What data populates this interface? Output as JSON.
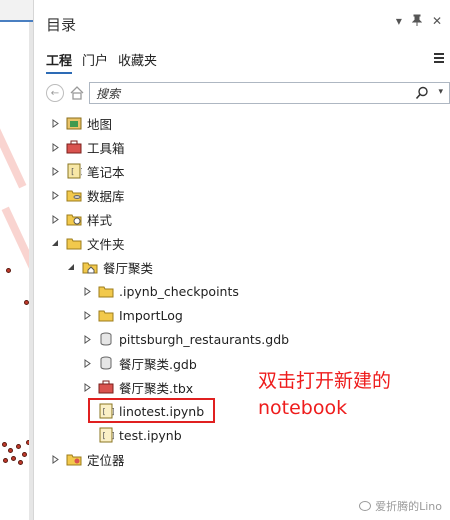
{
  "pane": {
    "title": "目录",
    "tabs": [
      {
        "label": "工程",
        "active": true
      },
      {
        "label": "门户",
        "active": false
      },
      {
        "label": "收藏夹",
        "active": false
      }
    ]
  },
  "search": {
    "placeholder": "搜索"
  },
  "tree": {
    "map": "地图",
    "toolbox": "工具箱",
    "notebook": "笔记本",
    "database": "数据库",
    "style": "样式",
    "folder": "文件夹",
    "project_folder": "餐厅聚类",
    "children": [
      ".ipynb_checkpoints",
      "ImportLog",
      "pittsburgh_restaurants.gdb",
      "餐厅聚类.gdb",
      "餐厅聚类.tbx",
      "linotest.ipynb",
      "test.ipynb"
    ],
    "locator": "定位器"
  },
  "annotation": {
    "line1": "双击打开新建的",
    "line2": "notebook"
  },
  "watermark": "爱折腾的Lino",
  "colors": {
    "accent": "#2d6bb5",
    "annotation": "#ee1c1c",
    "folder": "#f2c94c"
  }
}
